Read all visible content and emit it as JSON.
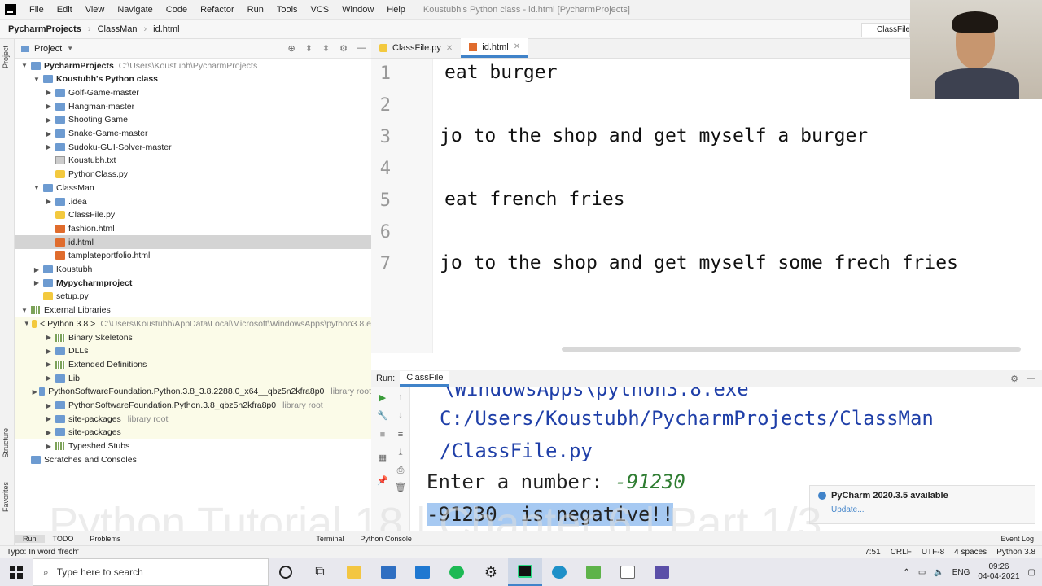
{
  "menubar": {
    "items": [
      "File",
      "Edit",
      "View",
      "Navigate",
      "Code",
      "Refactor",
      "Run",
      "Tools",
      "VCS",
      "Window",
      "Help"
    ],
    "window_title": "Koustubh's Python class - id.html [PycharmProjects]"
  },
  "navbar": {
    "project": "PycharmProjects",
    "folder": "ClassMan",
    "file": "id.html",
    "right_tab": "ClassFile"
  },
  "side_tabs": {
    "project": "Project",
    "structure": "Structure",
    "favorites": "Favorites"
  },
  "project_panel": {
    "title": "Project",
    "tree": [
      {
        "label": "PycharmProjects",
        "path": "C:\\Users\\Koustubh\\PycharmProjects",
        "depth": 0,
        "type": "folder",
        "open": true,
        "bold": true
      },
      {
        "label": "Koustubh's Python class",
        "depth": 1,
        "type": "folder",
        "open": true,
        "bold": true
      },
      {
        "label": "Golf-Game-master",
        "depth": 2,
        "type": "folder",
        "open": false
      },
      {
        "label": "Hangman-master",
        "depth": 2,
        "type": "folder",
        "open": false
      },
      {
        "label": "Shooting Game",
        "depth": 2,
        "type": "folder",
        "open": false
      },
      {
        "label": "Snake-Game-master",
        "depth": 2,
        "type": "folder",
        "open": false
      },
      {
        "label": "Sudoku-GUI-Solver-master",
        "depth": 2,
        "type": "folder",
        "open": false
      },
      {
        "label": "Koustubh.txt",
        "depth": 2,
        "type": "txt"
      },
      {
        "label": "PythonClass.py",
        "depth": 2,
        "type": "py"
      },
      {
        "label": "ClassMan",
        "depth": 1,
        "type": "folder",
        "open": true
      },
      {
        "label": ".idea",
        "depth": 2,
        "type": "folder",
        "open": false
      },
      {
        "label": "ClassFile.py",
        "depth": 2,
        "type": "py"
      },
      {
        "label": "fashion.html",
        "depth": 2,
        "type": "html"
      },
      {
        "label": "id.html",
        "depth": 2,
        "type": "html",
        "selected": true
      },
      {
        "label": "tamplateportfolio.html",
        "depth": 2,
        "type": "html"
      },
      {
        "label": "Koustubh",
        "depth": 1,
        "type": "folder",
        "open": false
      },
      {
        "label": "Mypycharmproject",
        "depth": 1,
        "type": "folder",
        "open": false,
        "bold": true
      },
      {
        "label": "setup.py",
        "depth": 1,
        "type": "py"
      },
      {
        "label": "External Libraries",
        "depth": 0,
        "type": "lib",
        "open": true
      },
      {
        "label": "< Python 3.8 >",
        "path": "C:\\Users\\Koustubh\\AppData\\Local\\Microsoft\\WindowsApps\\python3.8.e",
        "depth": 1,
        "type": "py",
        "open": true,
        "lib": true
      },
      {
        "label": "Binary Skeletons",
        "depth": 2,
        "type": "lib",
        "open": false,
        "lib": true
      },
      {
        "label": "DLLs",
        "depth": 2,
        "type": "folder",
        "open": false,
        "lib": true
      },
      {
        "label": "Extended Definitions",
        "depth": 2,
        "type": "lib",
        "open": false,
        "lib": true
      },
      {
        "label": "Lib",
        "depth": 2,
        "type": "folder",
        "open": false,
        "lib": true
      },
      {
        "label": "PythonSoftwareFoundation.Python.3.8_3.8.2288.0_x64__qbz5n2kfra8p0",
        "note": "library root",
        "depth": 2,
        "type": "folder",
        "open": false,
        "lib": true
      },
      {
        "label": "PythonSoftwareFoundation.Python.3.8_qbz5n2kfra8p0",
        "note": "library root",
        "depth": 2,
        "type": "folder",
        "open": false,
        "lib": true
      },
      {
        "label": "site-packages",
        "note": "library root",
        "depth": 2,
        "type": "folder",
        "open": false,
        "lib": true
      },
      {
        "label": "site-packages",
        "depth": 2,
        "type": "folder",
        "open": false,
        "lib": true
      },
      {
        "label": "Typeshed Stubs",
        "depth": 2,
        "type": "lib",
        "open": false
      },
      {
        "label": "Scratches and Consoles",
        "depth": 0,
        "type": "scratch"
      }
    ]
  },
  "editor": {
    "tabs": [
      {
        "label": "ClassFile.py",
        "active": false
      },
      {
        "label": "id.html",
        "active": true
      }
    ],
    "lines": [
      {
        "num": "1",
        "text": "eat burger"
      },
      {
        "num": "2",
        "text": ""
      },
      {
        "num": "3",
        "text": "jo to the shop and get myself a burger"
      },
      {
        "num": "4",
        "text": ""
      },
      {
        "num": "5",
        "text": "eat french fries"
      },
      {
        "num": "6",
        "text": ""
      },
      {
        "num": "7",
        "text": "jo to the shop and get myself some frech fries"
      }
    ]
  },
  "run": {
    "label": "Run:",
    "tab": "ClassFile",
    "console": {
      "line0": "\\WindowsApps\\python3.8.exe",
      "line1": "C:/Users/Koustubh/PycharmProjects/ClassMan",
      "line2": "/ClassFile.py",
      "prompt": "Enter a number: ",
      "input": "-91230",
      "result": "-91230  is negative!!"
    }
  },
  "notification": {
    "title": "PyCharm 2020.3.5 available",
    "link": "Update..."
  },
  "watermark": "Python Tutorial 18 | Chapter 6 | Part 1/3",
  "bottom_tabs": [
    "Run",
    "TODO",
    "Problems",
    "Terminal",
    "Python Console",
    "Event Log"
  ],
  "statusbar": {
    "message": "Typo: In word 'frech'",
    "position": "7:51",
    "line_sep": "CRLF",
    "encoding": "UTF-8",
    "indent": "4 spaces",
    "interpreter": "Python 3.8"
  },
  "taskbar": {
    "search_placeholder": "Type here to search",
    "lang": "ENG",
    "time": "09:26",
    "date": "04-04-2021"
  }
}
